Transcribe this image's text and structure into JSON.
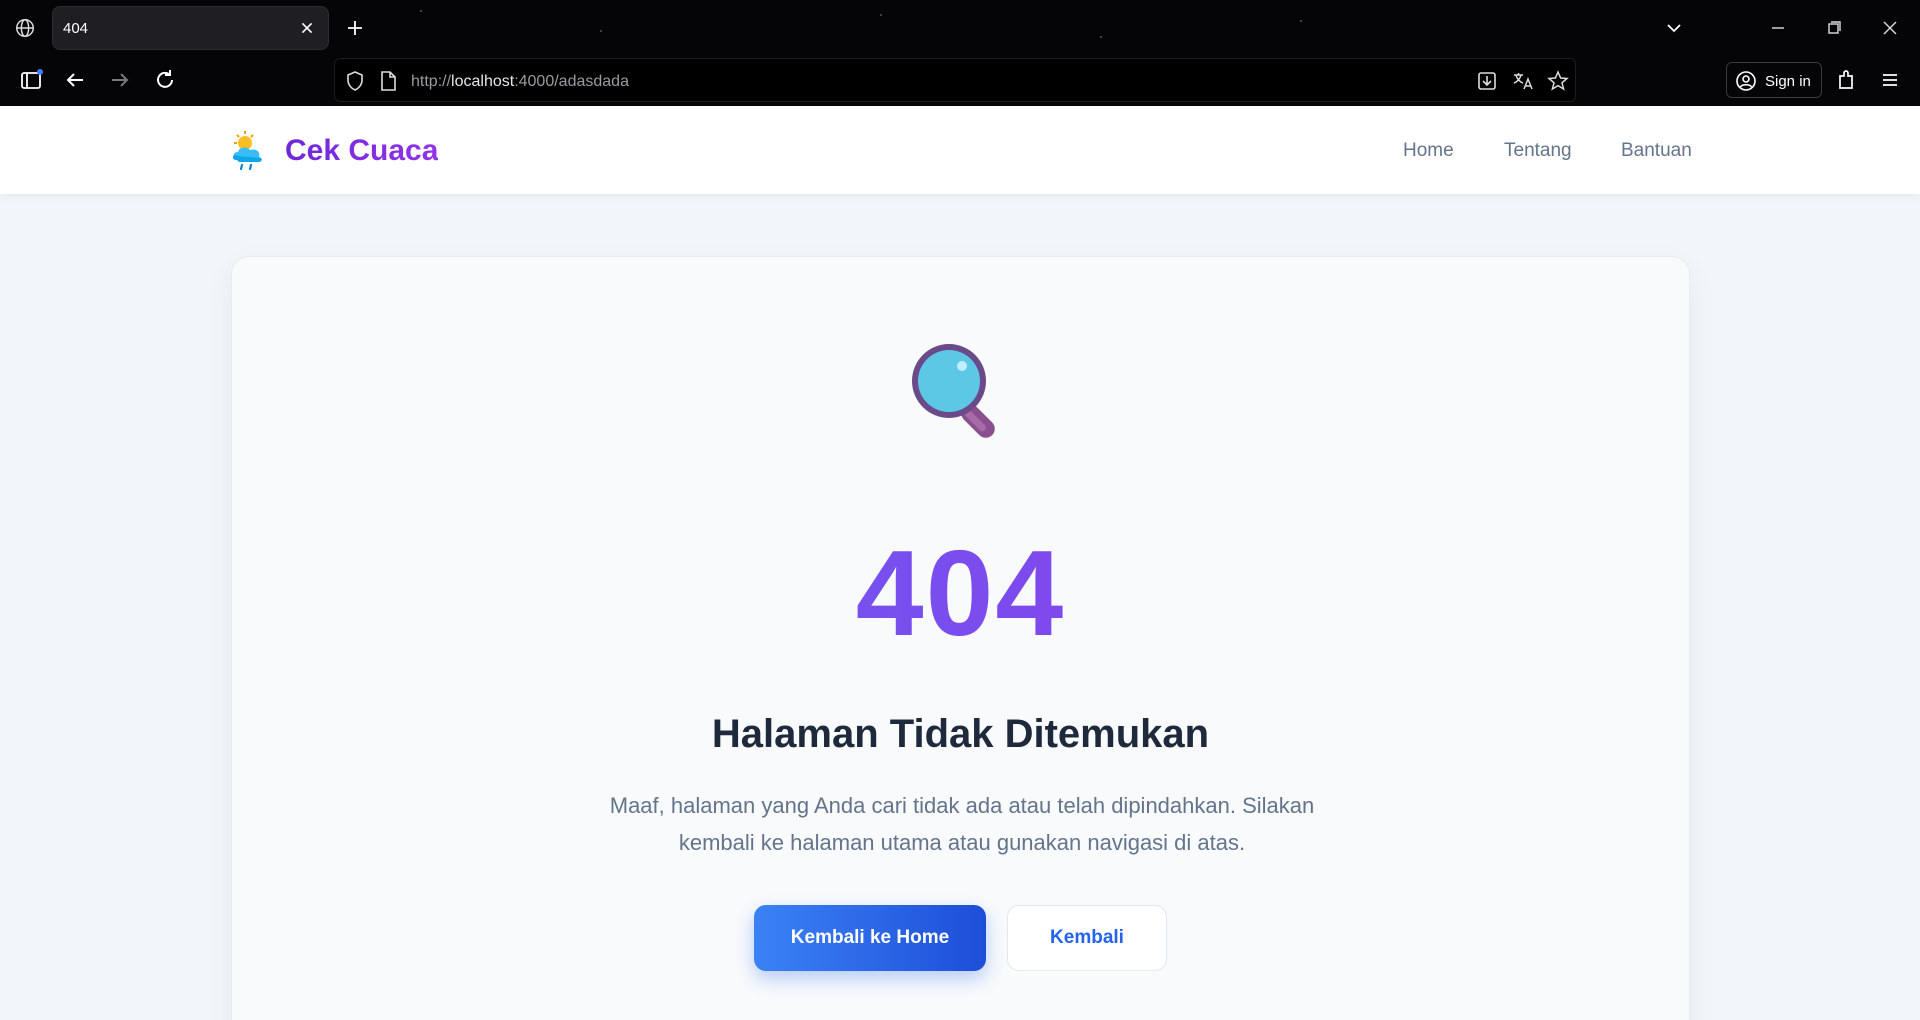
{
  "browser": {
    "tab": {
      "title": "404"
    },
    "url": {
      "prefix": "http://",
      "host": "localhost",
      "rest": ":4000/adasdada"
    },
    "signin_label": "Sign in"
  },
  "navbar": {
    "brand": "Cek Cuaca",
    "links": [
      "Home",
      "Tentang",
      "Bantuan"
    ]
  },
  "error": {
    "code": "404",
    "title": "Halaman Tidak Ditemukan",
    "description": "Maaf, halaman yang Anda cari tidak ada atau telah dipindahkan. Silakan kembali ke halaman utama atau gunakan navigasi di atas.",
    "primary_button": "Kembali ke Home",
    "secondary_button": "Kembali"
  },
  "colors": {
    "brand": "#7c3aed",
    "primary": "#2563eb",
    "accent_gradient": [
      "#6366f1",
      "#9333ea"
    ]
  },
  "icons": {
    "brand": "weather-sun-cloud-rain-icon",
    "hero": "magnifying-glass-icon"
  }
}
